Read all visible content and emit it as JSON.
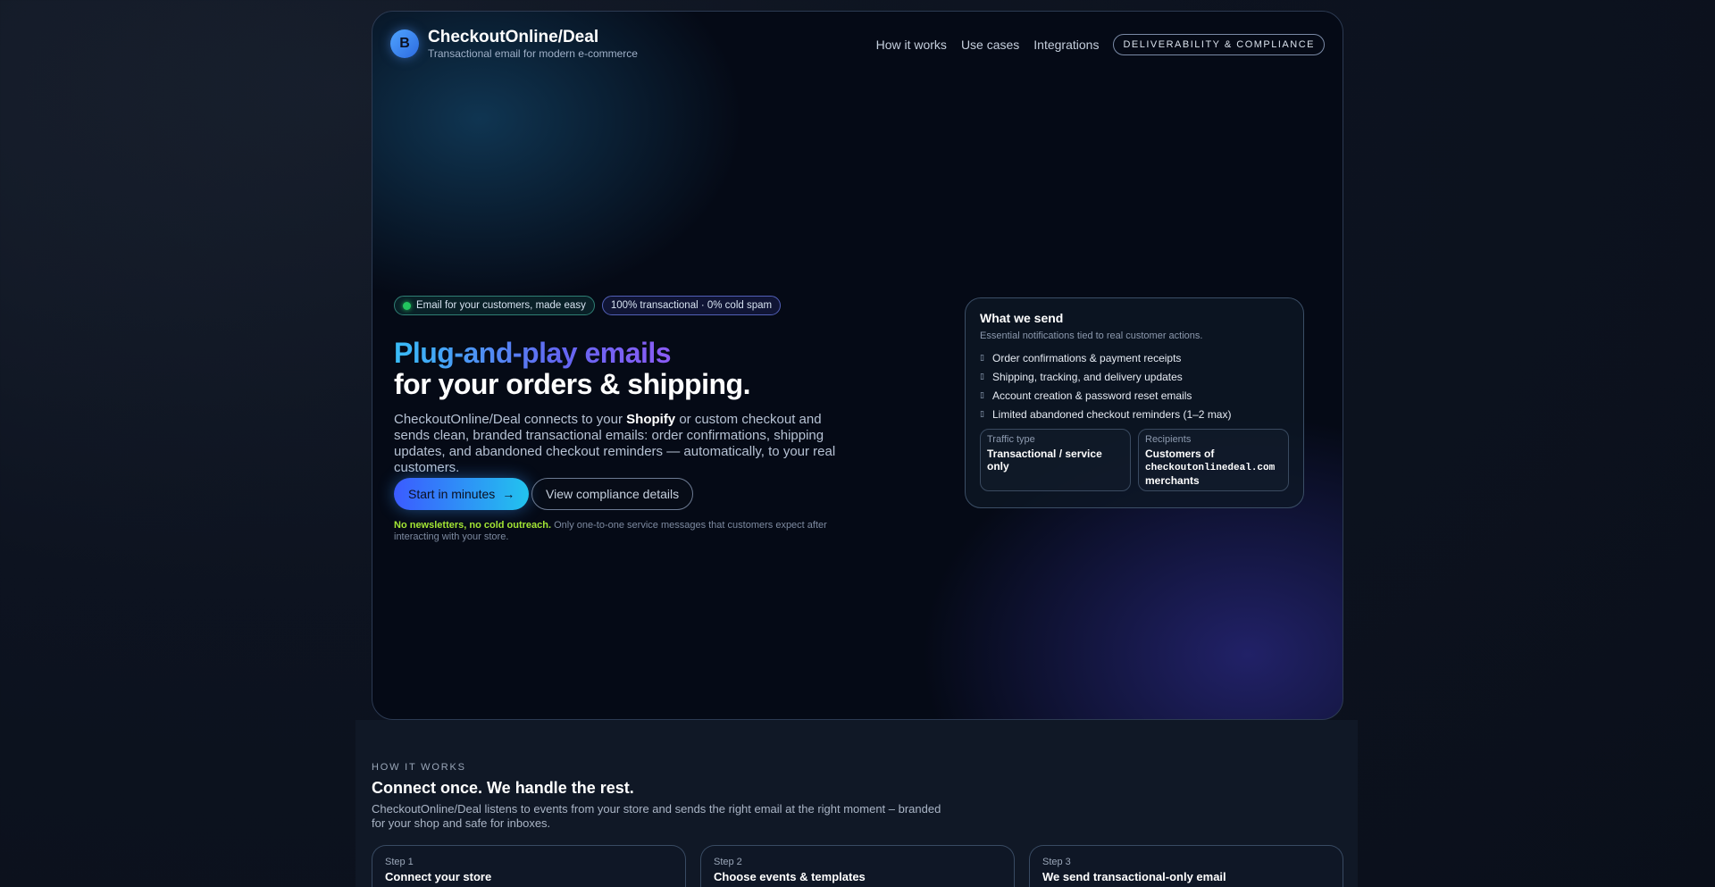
{
  "brand": {
    "logo_letter": "B",
    "name": "CheckoutOnline/Deal",
    "tagline": "Transactional email for modern e-commerce"
  },
  "nav": {
    "links": [
      "How it works",
      "Use cases",
      "Integrations"
    ],
    "cta": "DELIVERABILITY & COMPLIANCE"
  },
  "hero": {
    "pills": [
      "Email for your customers, made easy",
      "100% transactional · 0% cold spam"
    ],
    "headline_gradient": "Plug-and-play emails",
    "headline_plain": "for your orders & shipping.",
    "lead_before": "CheckoutOnline/Deal connects to your ",
    "lead_bold": "Shopify",
    "lead_after": " or custom checkout and sends clean, branded transactional emails: order confirmations, shipping updates, and abandoned checkout reminders — automatically, to your real customers.",
    "primary_button": "Start in minutes",
    "primary_arrow": "→",
    "secondary_button": "View compliance details",
    "note_bold": "No newsletters, no cold outreach.",
    "note_rest": " Only one-to-one service messages that customers expect after interacting with your store."
  },
  "what_we_send": {
    "title": "What we send",
    "subtitle": "Essential notifications tied to real customer actions.",
    "items": [
      "Order confirmations & payment receipts",
      "Shipping, tracking, and delivery updates",
      "Account creation & password reset emails",
      "Limited abandoned checkout reminders (1–2 max)"
    ],
    "traffic_label": "Traffic type",
    "traffic_value": "Transactional / service only",
    "recipients_label": "Recipients",
    "recipients_prefix": "Customers of",
    "recipients_domain": "checkoutonlinedeal.com",
    "recipients_suffix": "merchants"
  },
  "how_it_works": {
    "kicker": "HOW IT WORKS",
    "title": "Connect once. We handle the rest.",
    "description": "CheckoutOnline/Deal listens to events from your store and sends the right email at the right moment – branded for your shop and safe for inboxes.",
    "steps": [
      {
        "number": "Step 1",
        "title": "Connect your store"
      },
      {
        "number": "Step 2",
        "title": "Choose events & templates"
      },
      {
        "number": "Step 3",
        "title": "We send transactional-only email"
      }
    ]
  },
  "colors": {
    "accent_blue": "#38bdf8",
    "accent_violet": "#8b5cf6",
    "success_green": "#22c55e",
    "note_highlight": "#a3e635"
  }
}
